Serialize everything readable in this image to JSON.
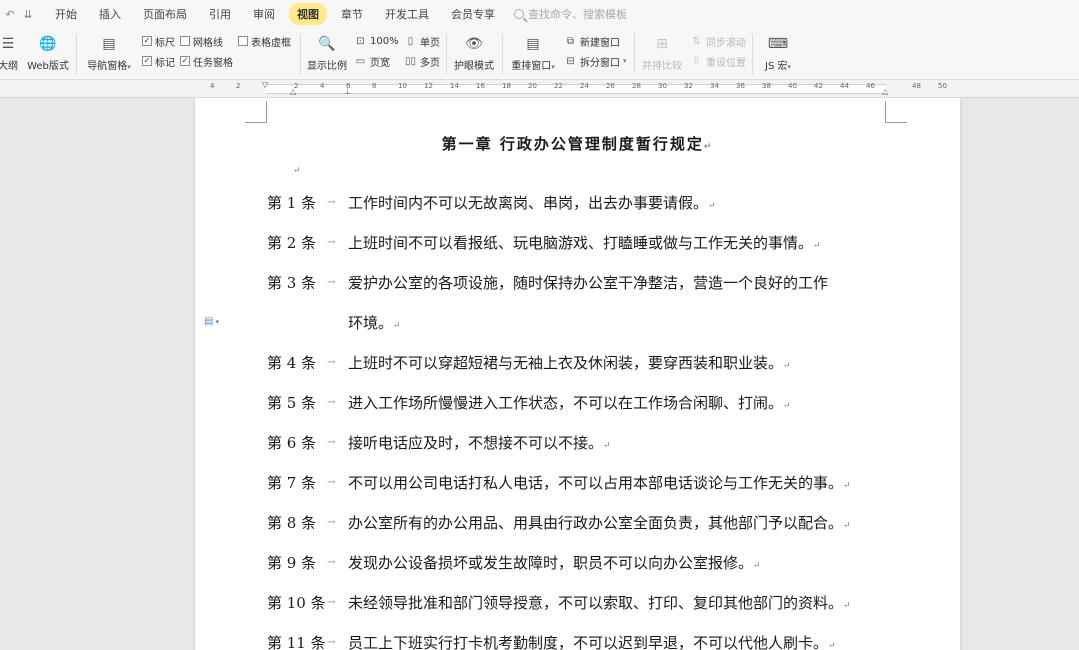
{
  "quick_access": {
    "undo": "↶",
    "more": "⇊"
  },
  "menu": {
    "tabs": [
      "开始",
      "插入",
      "页面布局",
      "引用",
      "审阅",
      "视图",
      "章节",
      "开发工具",
      "会员专享"
    ],
    "active_tab": "视图",
    "search_placeholder": "查找命令、搜索模板"
  },
  "ribbon": {
    "outline": "大纲",
    "web_layout": "Web版式",
    "nav_pane": "导航窗格",
    "ruler": {
      "label": "标尺",
      "checked": true
    },
    "gridlines": {
      "label": "网格线",
      "checked": false
    },
    "table_dashed": {
      "label": "表格虚框",
      "checked": false
    },
    "markup": {
      "label": "标记",
      "checked": true
    },
    "task_pane": {
      "label": "任务窗格",
      "checked": true
    },
    "zoom": "显示比例",
    "zoom_100": "100%",
    "one_page": "单页",
    "page_width": "页宽",
    "multi_page": "多页",
    "eye_mode": "护眼模式",
    "arrange_windows": "重排窗口",
    "new_window": "新建窗口",
    "split_window": "拆分窗口",
    "side_by_side": "并排比较",
    "sync_scroll": "同步滚动",
    "reset_position": "重设位置",
    "js_macro": "JS 宏"
  },
  "ruler_numbers": [
    "4",
    "2",
    "2",
    "4",
    "6",
    "8",
    "10",
    "12",
    "14",
    "16",
    "18",
    "20",
    "22",
    "24",
    "26",
    "28",
    "30",
    "32",
    "34",
    "36",
    "38",
    "40",
    "42",
    "44",
    "46",
    "48",
    "50"
  ],
  "document": {
    "title": "第一章 行政办公管理制度暂行规定",
    "clauses": [
      {
        "num": "第 1 条",
        "text": "工作时间内不可以无故离岗、串岗，出去办事要请假。"
      },
      {
        "num": "第 2 条",
        "text": "上班时间不可以看报纸、玩电脑游戏、打瞌睡或做与工作无关的事情。"
      },
      {
        "num": "第 3 条",
        "text": "爱护办公室的各项设施，随时保持办公室干净整洁，营造一个良好的工作",
        "cont": "环境。"
      },
      {
        "num": "第 4 条",
        "text": "上班时不可以穿超短裙与无袖上衣及休闲装，要穿西装和职业装。"
      },
      {
        "num": "第 5 条",
        "text": "进入工作场所慢慢进入工作状态，不可以在工作场合闲聊、打闹。"
      },
      {
        "num": "第 6 条",
        "text": "接听电话应及时，不想接不可以不接。"
      },
      {
        "num": "第 7 条",
        "text": "不可以用公司电话打私人电话，不可以占用本部电话谈论与工作无关的事。"
      },
      {
        "num": "第 8 条",
        "text": "办公室所有的办公用品、用具由行政办公室全面负责，其他部门予以配合。"
      },
      {
        "num": "第 9 条",
        "text": "发现办公设备损坏或发生故障时，职员不可以向办公室报修。"
      },
      {
        "num": "第 10 条",
        "text": "未经领导批准和部门领导授意，不可以索取、打印、复印其他部门的资料。"
      },
      {
        "num": "第 11 条",
        "text": "员工上下班实行打卡机考勤制度，不可以迟到早退，不可以代他人刷卡。"
      }
    ]
  }
}
